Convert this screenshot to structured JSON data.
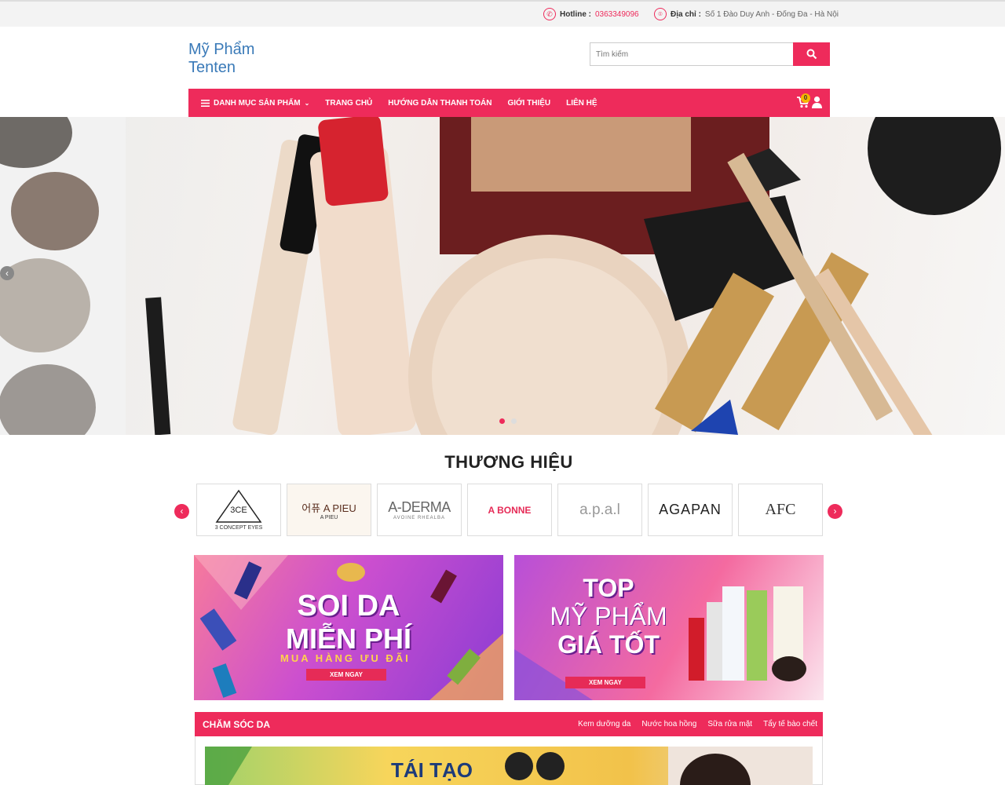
{
  "topbar": {
    "hotline_label": "Hotline :",
    "hotline_value": "0363349096",
    "address_label": "Địa chỉ :",
    "address_value": "Số 1 Đào Duy Anh - Đống Đa - Hà Nội"
  },
  "brand": {
    "line1": "Mỹ Phẩm",
    "line2": "Tenten"
  },
  "search": {
    "placeholder": "Tìm kiếm"
  },
  "nav": {
    "items": [
      "DANH MỤC SẢN PHẨM",
      "TRANG CHỦ",
      "HƯỚNG DẪN THANH TOÁN",
      "GIỚI THIỆU",
      "LIÊN HỆ"
    ],
    "cart_count": "0"
  },
  "brands": {
    "title": "THƯƠNG HIỆU",
    "logos": [
      "3CE",
      "어퓨 A PIEU",
      "A-DERMA",
      "A BONNE",
      "a.p.a.l",
      "AGAPAN",
      "AFC"
    ],
    "logo_captions": [
      "3 CONCEPT EYES",
      "A PIEU",
      "AVOINE RHEALBA",
      "",
      "",
      "",
      ""
    ]
  },
  "banners": {
    "left": {
      "line1": "SOI DA",
      "line2": "MIỄN PHÍ",
      "sub": "MUA HÀNG ƯU ĐÃI",
      "button": "XEM NGAY"
    },
    "right": {
      "line1": "TOP",
      "line2": "MỸ PHẨM",
      "line3": "GIÁ TỐT",
      "button": "XEM NGAY"
    }
  },
  "section": {
    "title": "CHĂM SÓC DA",
    "links": [
      "Kem dưỡng da",
      "Nước hoa hồng",
      "Sữa rửa mặt",
      "Tẩy tế bào chết"
    ],
    "promo_text": "TÁI TẠO"
  },
  "colors": {
    "accent": "#ee2b5b",
    "logo": "#3a7ab8"
  },
  "icons": [
    "phone-icon",
    "location-icon",
    "search-icon",
    "menu-icon",
    "cart-icon",
    "user-icon"
  ]
}
